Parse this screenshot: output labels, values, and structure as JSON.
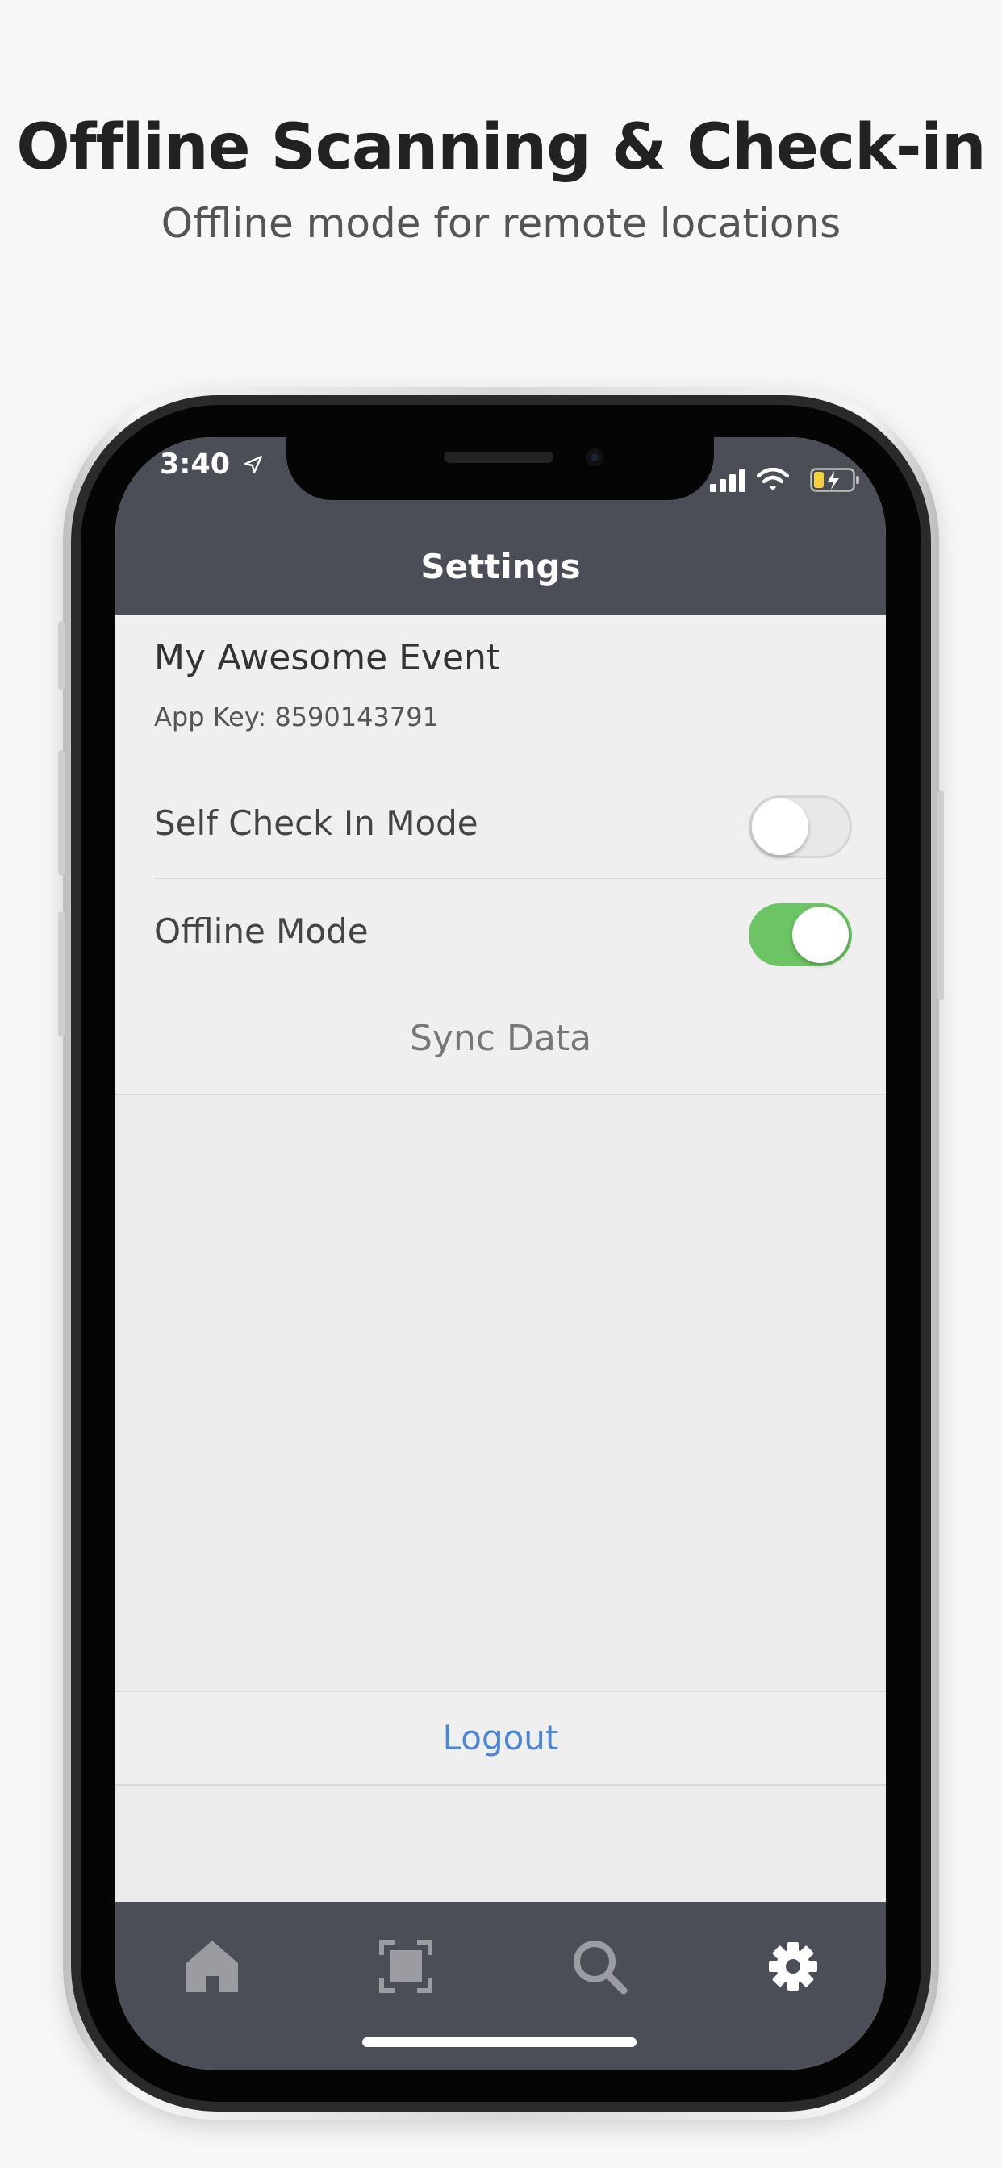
{
  "headline": "Offline Scanning & Check-in",
  "subheadline": "Offline mode for remote locations",
  "status_bar": {
    "time": "3:40"
  },
  "header": {
    "title": "Settings"
  },
  "event": {
    "name": "My Awesome Event",
    "app_key": "App Key: 8590143791"
  },
  "settings": [
    {
      "label": "Self Check In Mode",
      "enabled": false
    },
    {
      "label": "Offline Mode",
      "enabled": true
    }
  ],
  "sync_label": "Sync Data",
  "logout_label": "Logout",
  "tabs": [
    {
      "icon": "home-icon"
    },
    {
      "icon": "scan-icon"
    },
    {
      "icon": "search-icon"
    },
    {
      "icon": "gear-icon",
      "active": true
    }
  ],
  "colors": {
    "header_bg": "#4b4e56",
    "toggle_on": "#6cc464",
    "link": "#4a86d4"
  }
}
